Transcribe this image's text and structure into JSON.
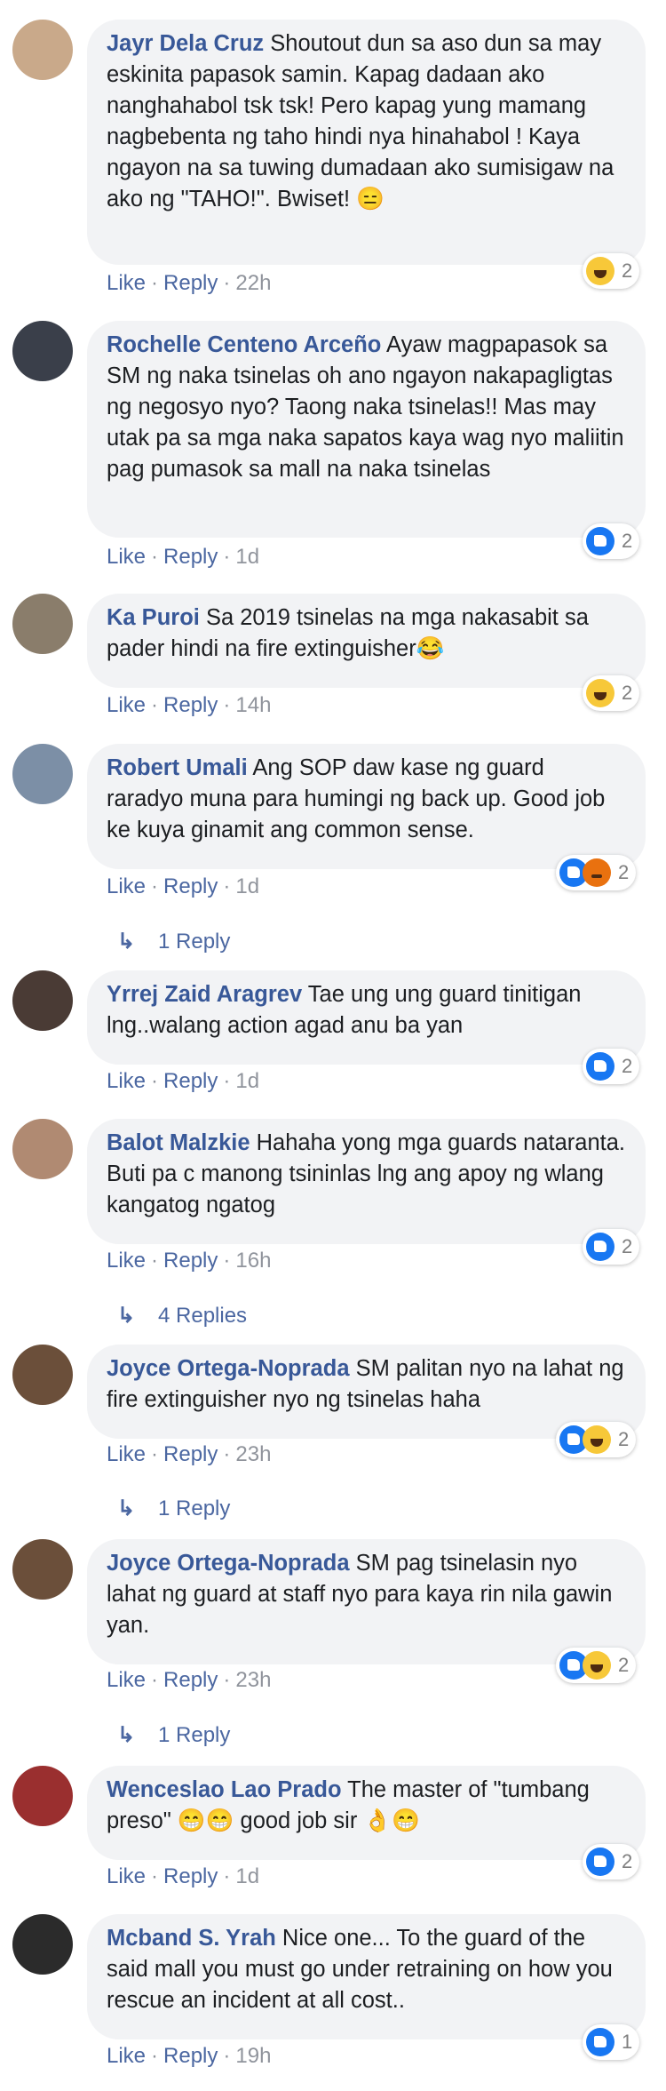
{
  "meta_labels": {
    "like": "Like",
    "reply": "Reply",
    "sep": "·"
  },
  "comments": [
    {
      "author": "Jayr Dela Cruz",
      "text": " Shoutout dun sa aso dun sa may eskinita papasok samin. Kapag dadaan ako nanghahabol tsk tsk! Pero kapag yung mamang nagbebenta ng taho hindi nya hinahabol ! Kaya ngayon na sa tuwing dumadaan ako sumisigaw na ako ng \"TAHO!\". Bwiset! 😑",
      "time": "22h",
      "reactions": {
        "icons": [
          "haha-icon"
        ],
        "count": "2"
      },
      "avatar_color": "#c9a98a"
    },
    {
      "author": "Rochelle Centeno Arceño",
      "text": " Ayaw magpapasok sa SM ng naka tsinelas oh ano ngayon nakapagligtas ng negosyo nyo? Taong naka tsinelas!! Mas may utak pa sa mga naka sapatos kaya wag nyo maliitin pag pumasok sa mall na naka tsinelas",
      "time": "1d",
      "reactions": {
        "icons": [
          "like-icon"
        ],
        "count": "2"
      },
      "avatar_color": "#3a3f4a"
    },
    {
      "author": "Ka Puroi",
      "text": " Sa 2019 tsinelas na mga nakasabit sa pader hindi na fire extinguisher😂",
      "time": "14h",
      "reactions": {
        "icons": [
          "haha-icon"
        ],
        "count": "2"
      },
      "avatar_color": "#8a7d6b"
    },
    {
      "author": "Robert Umali",
      "text": " Ang SOP daw kase ng guard raradyo muna para humingi ng back up. Good job ke kuya ginamit ang common sense.",
      "time": "1d",
      "reactions": {
        "icons": [
          "like-icon",
          "angry-icon"
        ],
        "count": "2"
      },
      "avatar_color": "#7c8fa6",
      "replies": "1 Reply"
    },
    {
      "author": "Yrrej Zaid Aragrev",
      "text": " Tae ung ung guard tinitigan lng..walang action agad anu ba yan",
      "time": "1d",
      "reactions": {
        "icons": [
          "like-icon"
        ],
        "count": "2"
      },
      "avatar_color": "#4a3b35"
    },
    {
      "author": "Balot Malzkie",
      "text": " Hahaha yong mga guards nataranta. Buti pa c manong tsininlas lng ang apoy ng wlang kangatog ngatog",
      "time": "16h",
      "reactions": {
        "icons": [
          "like-icon"
        ],
        "count": "2"
      },
      "avatar_color": "#b08a72",
      "replies": "4 Replies"
    },
    {
      "author": "Joyce Ortega-Noprada",
      "text": " SM palitan nyo na lahat ng fire extinguisher nyo ng tsinelas haha",
      "time": "23h",
      "reactions": {
        "icons": [
          "like-icon",
          "haha-icon"
        ],
        "count": "2"
      },
      "avatar_color": "#6b4f3a",
      "replies": "1 Reply"
    },
    {
      "author": "Joyce Ortega-Noprada",
      "text": " SM pag tsinelasin nyo lahat ng guard at staff nyo para kaya rin nila gawin yan.",
      "time": "23h",
      "reactions": {
        "icons": [
          "like-icon",
          "haha-icon"
        ],
        "count": "2"
      },
      "avatar_color": "#6b4f3a",
      "replies": "1 Reply"
    },
    {
      "author": "Wenceslao Lao Prado",
      "text": " The master of \"tumbang preso\" 😁😁 good job sir 👌😁",
      "time": "1d",
      "reactions": {
        "icons": [
          "like-icon"
        ],
        "count": "2"
      },
      "avatar_color": "#9a2f2f"
    },
    {
      "author": "Mcband S. Yrah",
      "text": " Nice one... To the guard of the said mall you must go under retraining on how you rescue an incident at all cost..",
      "time": "19h",
      "reactions": {
        "icons": [
          "like-icon"
        ],
        "count": "1"
      },
      "avatar_color": "#2b2b2b"
    }
  ]
}
